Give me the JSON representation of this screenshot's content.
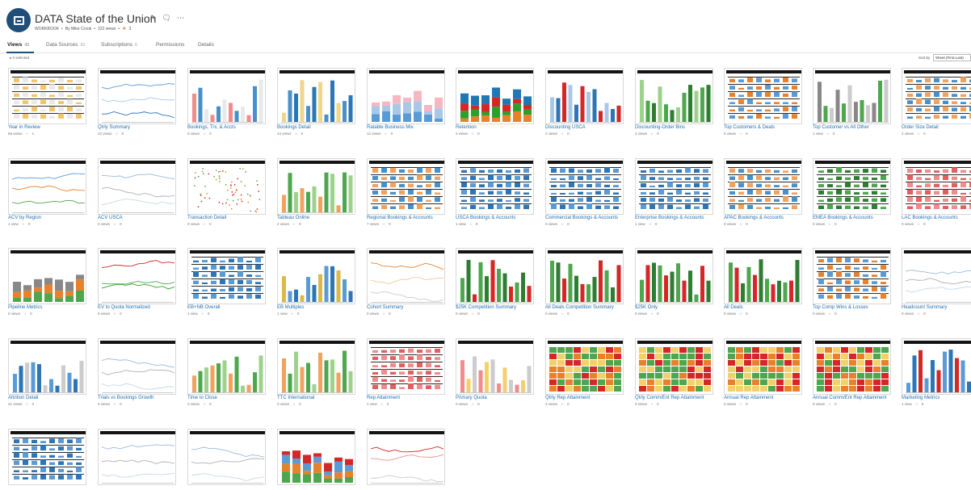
{
  "header": {
    "title": "DATA State of the Union",
    "icons": [
      "edit-icon",
      "comment-icon",
      "more-icon"
    ],
    "meta_type": "WORKBOOK",
    "meta_author": "By Mike Crook",
    "meta_views": "222 views",
    "meta_favorites": "3"
  },
  "tabs": [
    {
      "label": "Views",
      "count": "43",
      "active": true
    },
    {
      "label": "Data Sources",
      "count": "10"
    },
    {
      "label": "Subscriptions",
      "count": "0"
    },
    {
      "label": "Permissions",
      "count": ""
    },
    {
      "label": "Details",
      "count": ""
    }
  ],
  "toolbar": {
    "selected": "0 selected",
    "sort_label": "Sort by",
    "sort_value": "Sheet (First-Last)"
  },
  "accent": "#1f4e79",
  "link_color": "#1f6fb2",
  "views": [
    {
      "name": "Year in Review",
      "views": "68 views",
      "favs": "1",
      "style": "table"
    },
    {
      "name": "Qtrly Summary",
      "views": "22 views",
      "favs": "0",
      "style": "blue-lines"
    },
    {
      "name": "Bookings, Trx, & Accts",
      "views": "0 views",
      "favs": "0",
      "style": "pink-bars"
    },
    {
      "name": "Bookings Detail",
      "views": "14 views",
      "favs": "0",
      "style": "mix"
    },
    {
      "name": "Ratable Business Mix",
      "views": "12 views",
      "favs": "0",
      "style": "stacked"
    },
    {
      "name": "Retention",
      "views": "2 views",
      "favs": "0",
      "style": "color-blocks"
    },
    {
      "name": "Discounting USCA",
      "views": "2 views",
      "favs": "0",
      "style": "tall-bars"
    },
    {
      "name": "Discounting-Order Bins",
      "views": "2 views",
      "favs": "0",
      "style": "green-bars"
    },
    {
      "name": "Top Customers & Deals",
      "views": "0 views",
      "favs": "0",
      "style": "list"
    },
    {
      "name": "Top Customer vs All Other",
      "views": "1 view",
      "favs": "0",
      "style": "grey-green"
    },
    {
      "name": "Order Size Detail",
      "views": "2 views",
      "favs": "0",
      "style": "orange-table"
    },
    {
      "name": "ACV by Region",
      "views": "1 view",
      "favs": "0",
      "style": "lines"
    },
    {
      "name": "ACV USCA",
      "views": "0 views",
      "favs": "0",
      "style": "lines-light"
    },
    {
      "name": "Transaction Detail",
      "views": "0 views",
      "favs": "0",
      "style": "scatter"
    },
    {
      "name": "Tableau Online",
      "views": "4 views",
      "favs": "0",
      "style": "orange-green"
    },
    {
      "name": "Regional Bookings & Accounts",
      "views": "7 views",
      "favs": "0",
      "style": "orange-table"
    },
    {
      "name": "USCA Bookings & Accounts",
      "views": "1 view",
      "favs": "0",
      "style": "blue-table"
    },
    {
      "name": "Commercial Bookings & Accounts",
      "views": "0 views",
      "favs": "0",
      "style": "blue-table"
    },
    {
      "name": "Enterprise Bookings & Accounts",
      "views": "1 view",
      "favs": "0",
      "style": "blue-table"
    },
    {
      "name": "APAC Bookings & Accounts",
      "views": "0 views",
      "favs": "0",
      "style": "orange-table"
    },
    {
      "name": "EMEA Bookings & Accounts",
      "views": "0 views",
      "favs": "0",
      "style": "green-table"
    },
    {
      "name": "LAC Bookings & Accounts",
      "views": "0 views",
      "favs": "0",
      "style": "pink-table"
    },
    {
      "name": "Pipeline Metrics",
      "views": "0 views",
      "favs": "0",
      "style": "pipeline"
    },
    {
      "name": "EV to Quota Normalized",
      "views": "0 views",
      "favs": "0",
      "style": "curves"
    },
    {
      "name": "EB+NB Overall",
      "views": "1 view",
      "favs": "0",
      "style": "blue-table"
    },
    {
      "name": "EB Multiples",
      "views": "1 view",
      "favs": "0",
      "style": "yellow-bars"
    },
    {
      "name": "Cohort Summary",
      "views": "0 views",
      "favs": "0",
      "style": "cohort"
    },
    {
      "name": "$25K Competition Summary",
      "views": "0 views",
      "favs": "0",
      "style": "green-panels"
    },
    {
      "name": "All Deals Competition Summary",
      "views": "0 views",
      "favs": "0",
      "style": "green-panels"
    },
    {
      "name": "$25K Only",
      "views": "0 views",
      "favs": "0",
      "style": "green-red"
    },
    {
      "name": "All Deals",
      "views": "0 views",
      "favs": "0",
      "style": "green-red"
    },
    {
      "name": "Top Comp Wins & Losses",
      "views": "0 views",
      "favs": "0",
      "style": "list"
    },
    {
      "name": "Headcount Summary",
      "views": "0 views",
      "favs": "0",
      "style": "lines-light"
    },
    {
      "name": "Attrition Detail",
      "views": "21 views",
      "favs": "0",
      "style": "attrition"
    },
    {
      "name": "Trials vs Bookings Growth",
      "views": "0 views",
      "favs": "0",
      "style": "lines-light"
    },
    {
      "name": "Time to Close",
      "views": "0 views",
      "favs": "0",
      "style": "orange-green"
    },
    {
      "name": "TTC International",
      "views": "0 views",
      "favs": "0",
      "style": "orange-green"
    },
    {
      "name": "Rep Attainment",
      "views": "1 view",
      "favs": "0",
      "style": "pink-table"
    },
    {
      "name": "Primary Quota",
      "views": "0 views",
      "favs": "0",
      "style": "quota"
    },
    {
      "name": "Qtrly Rep Attainment",
      "views": "3 views",
      "favs": "0",
      "style": "heat"
    },
    {
      "name": "Qtrly Comm/Ent Rep Attainment",
      "views": "0 views",
      "favs": "0",
      "style": "heat"
    },
    {
      "name": "Annual Rep Attainment",
      "views": "0 views",
      "favs": "0",
      "style": "heat"
    },
    {
      "name": "Annual Comm/Ent Rep Attainment",
      "views": "0 views",
      "favs": "0",
      "style": "heat"
    },
    {
      "name": "Marketing Metrics",
      "views": "1 view",
      "favs": "0",
      "style": "blue-bars-side"
    },
    {
      "name": "",
      "views": "",
      "favs": "",
      "style": "blue-table"
    },
    {
      "name": "",
      "views": "",
      "favs": "",
      "style": "lines-light"
    },
    {
      "name": "",
      "views": "",
      "favs": "",
      "style": "lines-light"
    },
    {
      "name": "",
      "views": "",
      "favs": "",
      "style": "stack-colors"
    },
    {
      "name": "",
      "views": "",
      "favs": "",
      "style": "red-lines"
    }
  ]
}
